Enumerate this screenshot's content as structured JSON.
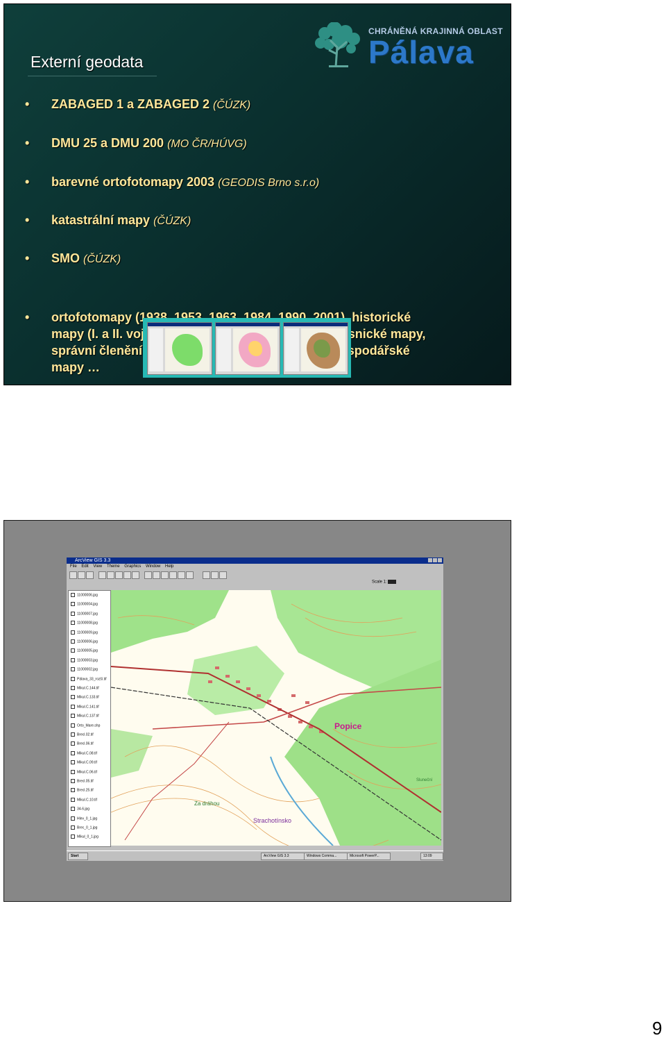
{
  "slide1": {
    "title": "Externí geodata",
    "logo": {
      "small": "CHRÁNĚNÁ KRAJINNÁ OBLAST",
      "big": "Pálava",
      "icon": "tree-logo-icon"
    },
    "bullets": [
      {
        "main": "ZABAGED 1 a ZABAGED 2 ",
        "source": "(ČÚZK)"
      },
      {
        "main": "DMU 25 a DMU 200 ",
        "source": "(MO ČR/HÚVG)"
      },
      {
        "main": "barevné ortofotomapy 2003 ",
        "source": "(GEODIS Brno s.r.o)"
      },
      {
        "main": "katastrální mapy ",
        "source": "(ČÚZK)"
      },
      {
        "main": "SMO ",
        "source": "(ČÚZK)"
      },
      {
        "main": "ortofotomapy (1938, 1953, 1963, 1984, 1990, 2001), historické mapy (I. a II. vojenské mapování), územní plány, lesnické mapy, správní členění, viniční tratě, půdní bloky, vodohospodářské mapy …",
        "source": ""
      }
    ],
    "colors": {
      "bullet_text": "#ffe79a",
      "title": "#ffffff",
      "logo_big": "#2c78c9",
      "thumb_frame": "#27b9b4"
    }
  },
  "slide2": {
    "window_title": "ArcView GIS 3.3",
    "menus": [
      "File",
      "Edit",
      "View",
      "Theme",
      "Graphics",
      "Window",
      "Help"
    ],
    "scale_label": "Scale 1:",
    "toc_layers": [
      "11000006.jpg",
      "11000004.jpg",
      "11000007.jpg",
      "11000008.jpg",
      "11000009.jpg",
      "11000006.jpg",
      "11000005.jpg",
      "11000003.jpg",
      "11000002.jpg",
      "Pálava_33_rozší.tif",
      "Mikul.C.144.tif",
      "Mikul.C.133.tif",
      "Mikul.C.141.tif",
      "Mikul.C.137.tif",
      "Orto_Mare.shp",
      "Brecl.02.tif",
      "Brecl.06.tif",
      "Mikul.C.08.tif",
      "Mikul.C.09.tif",
      "Mikul.C.06.tif",
      "Brecl.05.tif",
      "Brecl.25.tif",
      "Mikul.C.10.tif",
      "34-6.jpg",
      "Hlev_0_1.jpg",
      "Brec_0_1.jpg",
      "Mikul_0_1.jpg"
    ],
    "map_labels": [
      "Popice",
      "Strachotínsko",
      "Za dráhou",
      "Sluneční"
    ],
    "taskbar": [
      "Start",
      "ArcView GIS 3.3",
      "Windows Comma...",
      "Microsoft PowerP..."
    ],
    "clock": "13:09"
  },
  "page_number": "9"
}
